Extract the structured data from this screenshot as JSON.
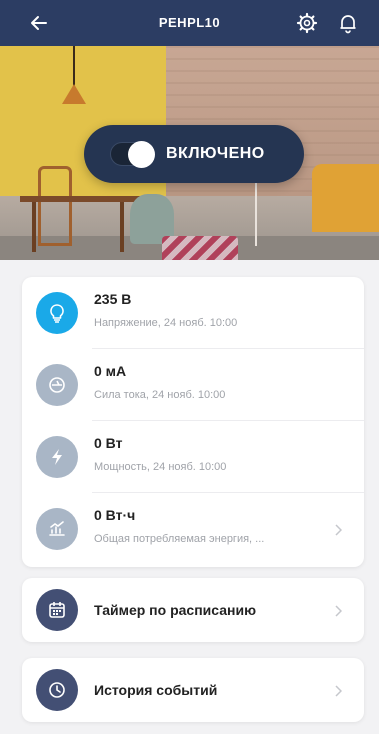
{
  "header": {
    "title": "PEHPL10",
    "back_icon": "back-arrow-icon",
    "settings_icon": "gear-icon",
    "notifications_icon": "bell-icon",
    "background_color": "#2c3d63"
  },
  "hero": {
    "toggle_label": "ВКЛЮЧЕНО",
    "toggle_on": true
  },
  "metrics": [
    {
      "icon": "lightbulb-icon",
      "value": "235 В",
      "subtitle": "Напряжение, 24 нояб. 10:00",
      "active": true
    },
    {
      "icon": "current-meter-icon",
      "value": "0 мА",
      "subtitle": "Сила тока, 24 нояб. 10:00",
      "active": false
    },
    {
      "icon": "lightning-icon",
      "value": "0 Вт",
      "subtitle": "Мощность, 24 нояб. 10:00",
      "active": false
    },
    {
      "icon": "energy-chart-icon",
      "value": "0 Вт·ч",
      "subtitle": "Общая потребляемая энергия, ...",
      "active": false,
      "has_chevron": true
    }
  ],
  "actions": {
    "timer_label": "Таймер по расписанию",
    "timer_icon": "calendar-icon",
    "history_label": "История событий",
    "history_icon": "clock-icon"
  },
  "colors": {
    "accent_blue": "#1aa9e8",
    "muted_icon": "#a9b6c6",
    "dark_icon": "#434f74"
  }
}
